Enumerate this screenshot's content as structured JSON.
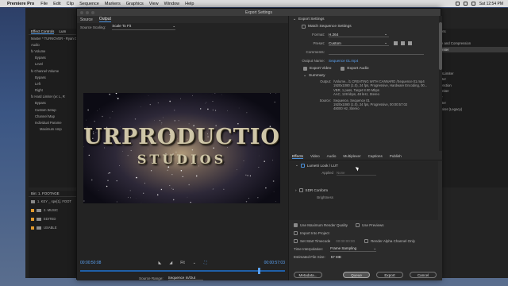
{
  "menubar": {
    "app": "Premiere Pro",
    "items": [
      "File",
      "Edit",
      "Clip",
      "Sequence",
      "Markers",
      "Graphics",
      "View",
      "Window",
      "Help"
    ],
    "clock": "Sat 12:54 PM"
  },
  "bg_left": {
    "tabs": [
      "Effect Controls",
      "Lum"
    ],
    "rows": [
      "Master * TURNOVER - Ryan C",
      "Audio",
      "fx Volume",
      "Bypass",
      "Level",
      "fx Channel Volume",
      "Bypass",
      "Left",
      "Right",
      "fx Hard Limiter (w: L, R",
      "Bypass",
      "Custom Setup",
      "Channel Map",
      "Individual Parame",
      "Maximum Amp"
    ]
  },
  "bg_bin": {
    "title": "Bin: 1. FOOTAGE",
    "rows": [
      "1. KEY _ spe[1]. FOOT",
      "2. MUSIC",
      "EDITED",
      "USABLE"
    ]
  },
  "bg_right": {
    "rows": [
      "nesets",
      "dio",
      "itude and Compression",
      "d Limiter",
      "",
      "le",
      "",
      "PassLimiter",
      "Limiter",
      "Correction",
      "d Limiter",
      "iliker",
      "Limiter",
      "t Limiter (Legacy)"
    ]
  },
  "dialog": {
    "title": "Export Settings",
    "source_tabs": [
      "Source",
      "Output"
    ],
    "source_scaling_label": "Source Scaling:",
    "source_scaling_value": "Scale To Fit",
    "preview_title_line1": "URPRODUCTION",
    "preview_title_line2": "STUDIOS",
    "timecode_in": "00:00:50:08",
    "fit_value": "Fit",
    "timecode_out": "00:00:57:03",
    "source_range_label": "Source Range:",
    "source_range_value": "Sequence In/Out"
  },
  "export_settings": {
    "header": "Export Settings",
    "match_sequence": "Match Sequence Settings",
    "format_label": "Format:",
    "format_value": "H.264",
    "preset_label": "Preset:",
    "preset_value": "Custom",
    "comments_label": "Comments:",
    "output_name_label": "Output Name:",
    "output_name_value": "Sequence 01.mp4",
    "export_video": "Export Video",
    "export_audio": "Export Audio",
    "summary_header": "Summary",
    "summary_output_label": "Output:",
    "summary_output_lines": [
      "/Volume.../1 CREATING WITH CANNARD /Sequence 01.mp4",
      "1920x1080 (1.0), 24 fps, Progressive, Hardware Encoding, 00...",
      "VBR, 1 pass, Target 8.00 Mbps",
      "AAC, 128 kbps, 48 kHz, Stereo"
    ],
    "summary_source_label": "Source:",
    "summary_source_lines": [
      "Sequence, Sequence 01",
      "1920x1080 (1.0), 24 fps, Progressive, 00:00:57:02",
      "48000 Hz, Stereo"
    ]
  },
  "panel_tabs": [
    "Effects",
    "Video",
    "Audio",
    "Multiplexer",
    "Captions",
    "Publish"
  ],
  "effects": {
    "lumetri": "Lumetri Look / LUT",
    "applied_label": "Applied",
    "applied_value": "None",
    "sdr": "SDR Conform",
    "brightness_label": "Brightness"
  },
  "options": {
    "max_render": "Use Maximum Render Quality",
    "use_previews": "Use Previews",
    "import_into_project": "Import Into Project",
    "set_start_tc": "Set Start Timecode",
    "start_tc_value": "00:00:00:00",
    "render_alpha": "Render Alpha Channel Only",
    "time_interp_label": "Time Interpolation:",
    "time_interp_value": "Frame Sampling",
    "file_size_label": "Estimated File Size:",
    "file_size_value": "57 MB"
  },
  "buttons": {
    "metadata": "Metadata...",
    "queue": "Queue",
    "export": "Export",
    "cancel": "Cancel"
  },
  "colors": {
    "accent": "#4a90d9",
    "timecode": "#5aa0f0",
    "label_orange": "#e0992e"
  }
}
